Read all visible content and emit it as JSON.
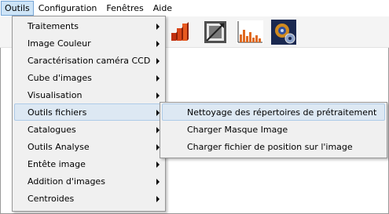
{
  "menubar": {
    "items": [
      {
        "label": "Outils",
        "active": true
      },
      {
        "label": "Configuration",
        "active": false
      },
      {
        "label": "Fenêtres",
        "active": false
      },
      {
        "label": "Aide",
        "active": false
      }
    ]
  },
  "toolbar": {
    "buttons": [
      {
        "icon": "bar-chart-3d-icon"
      },
      {
        "icon": "crop-frame-icon"
      },
      {
        "icon": "histogram-icon"
      },
      {
        "icon": "camera-gear-icon"
      }
    ]
  },
  "outils_menu": {
    "items": [
      {
        "label": "Traitements",
        "has_submenu": true
      },
      {
        "label": "Image Couleur",
        "has_submenu": true
      },
      {
        "label": "Caractérisation caméra CCD",
        "has_submenu": true
      },
      {
        "label": "Cube d'images",
        "has_submenu": true
      },
      {
        "label": "Visualisation",
        "has_submenu": true
      },
      {
        "label": "Outils fichiers",
        "has_submenu": true,
        "highlighted": true
      },
      {
        "label": "Catalogues",
        "has_submenu": true
      },
      {
        "label": "Outils Analyse",
        "has_submenu": true
      },
      {
        "label": "Entête image",
        "has_submenu": true
      },
      {
        "label": "Addition d'images",
        "has_submenu": true
      },
      {
        "label": "Centroides",
        "has_submenu": true
      }
    ]
  },
  "outils_fichiers_submenu": {
    "items": [
      {
        "label": "Nettoyage des répertoires de prétraitement",
        "highlighted": true
      },
      {
        "label": "Charger Masque Image",
        "highlighted": false
      },
      {
        "label": "Charger fichier de position sur l'image",
        "highlighted": false
      }
    ]
  },
  "colors": {
    "hover_bg": "#dde8f3",
    "hover_border": "#aecbe8",
    "menu_bg": "#f0f0f0"
  }
}
